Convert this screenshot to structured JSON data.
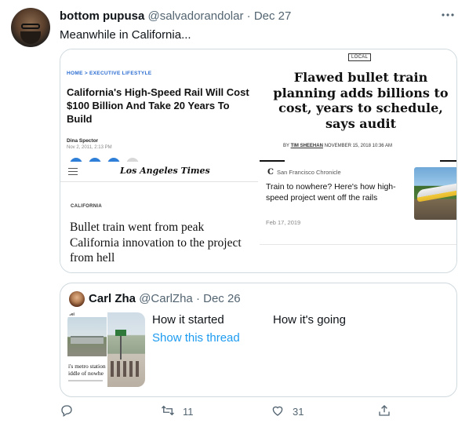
{
  "tweet": {
    "author_name": "bottom pupusa",
    "handle": "@salvadorandolar",
    "separator": "·",
    "date": "Dec 27",
    "text": "Meanwhile in California..."
  },
  "media": {
    "top_left": {
      "crumb_home": "HOME",
      "crumb_sep": ">",
      "crumb_section": "EXECUTIVE LIFESTYLE",
      "headline": "California's High-Speed Rail Will Cost $100 Billion And Take 20 Years To Build",
      "author": "Dina Spector",
      "date": "Nov 2, 2011, 2:13 PM"
    },
    "top_right": {
      "tag": "LOCAL",
      "headline": "Flawed bullet train planning adds billions to cost, years to schedule, says audit",
      "by_prefix": "BY",
      "by_author": "TIM SHEEHAN",
      "by_date": "NOVEMBER 15, 2018 10:36 AM"
    },
    "bottom_left": {
      "logo": "Los Angeles Times",
      "section": "CALIFORNIA",
      "headline": "Bullet train went from peak California innovation to the project from hell"
    },
    "bottom_right": {
      "icon_glyph": "C",
      "source": "San Francisco Chronicle",
      "headline": "Train to nowhere? Here's how high-speed project went off the rails",
      "date": "Feb 17, 2019"
    }
  },
  "quote": {
    "author_name": "Carl Zha",
    "handle": "@CarlZha",
    "separator": "·",
    "date": "Dec 26",
    "text_started": "How it started",
    "text_going": "How it's going",
    "show_thread": "Show this thread",
    "thumb_top": "vel",
    "thumb_caption_1": "i's metro station",
    "thumb_caption_2": "iddle of nowhe"
  },
  "actions": {
    "reply_count": "",
    "retweet_count": "11",
    "like_count": "31"
  },
  "colors": {
    "link": "#1d9bf0",
    "secondary_text": "#536471",
    "border": "#cfd9de"
  },
  "icons": [
    "more-icon",
    "reply-icon",
    "retweet-icon",
    "like-icon",
    "share-icon",
    "hamburger-menu-icon"
  ]
}
